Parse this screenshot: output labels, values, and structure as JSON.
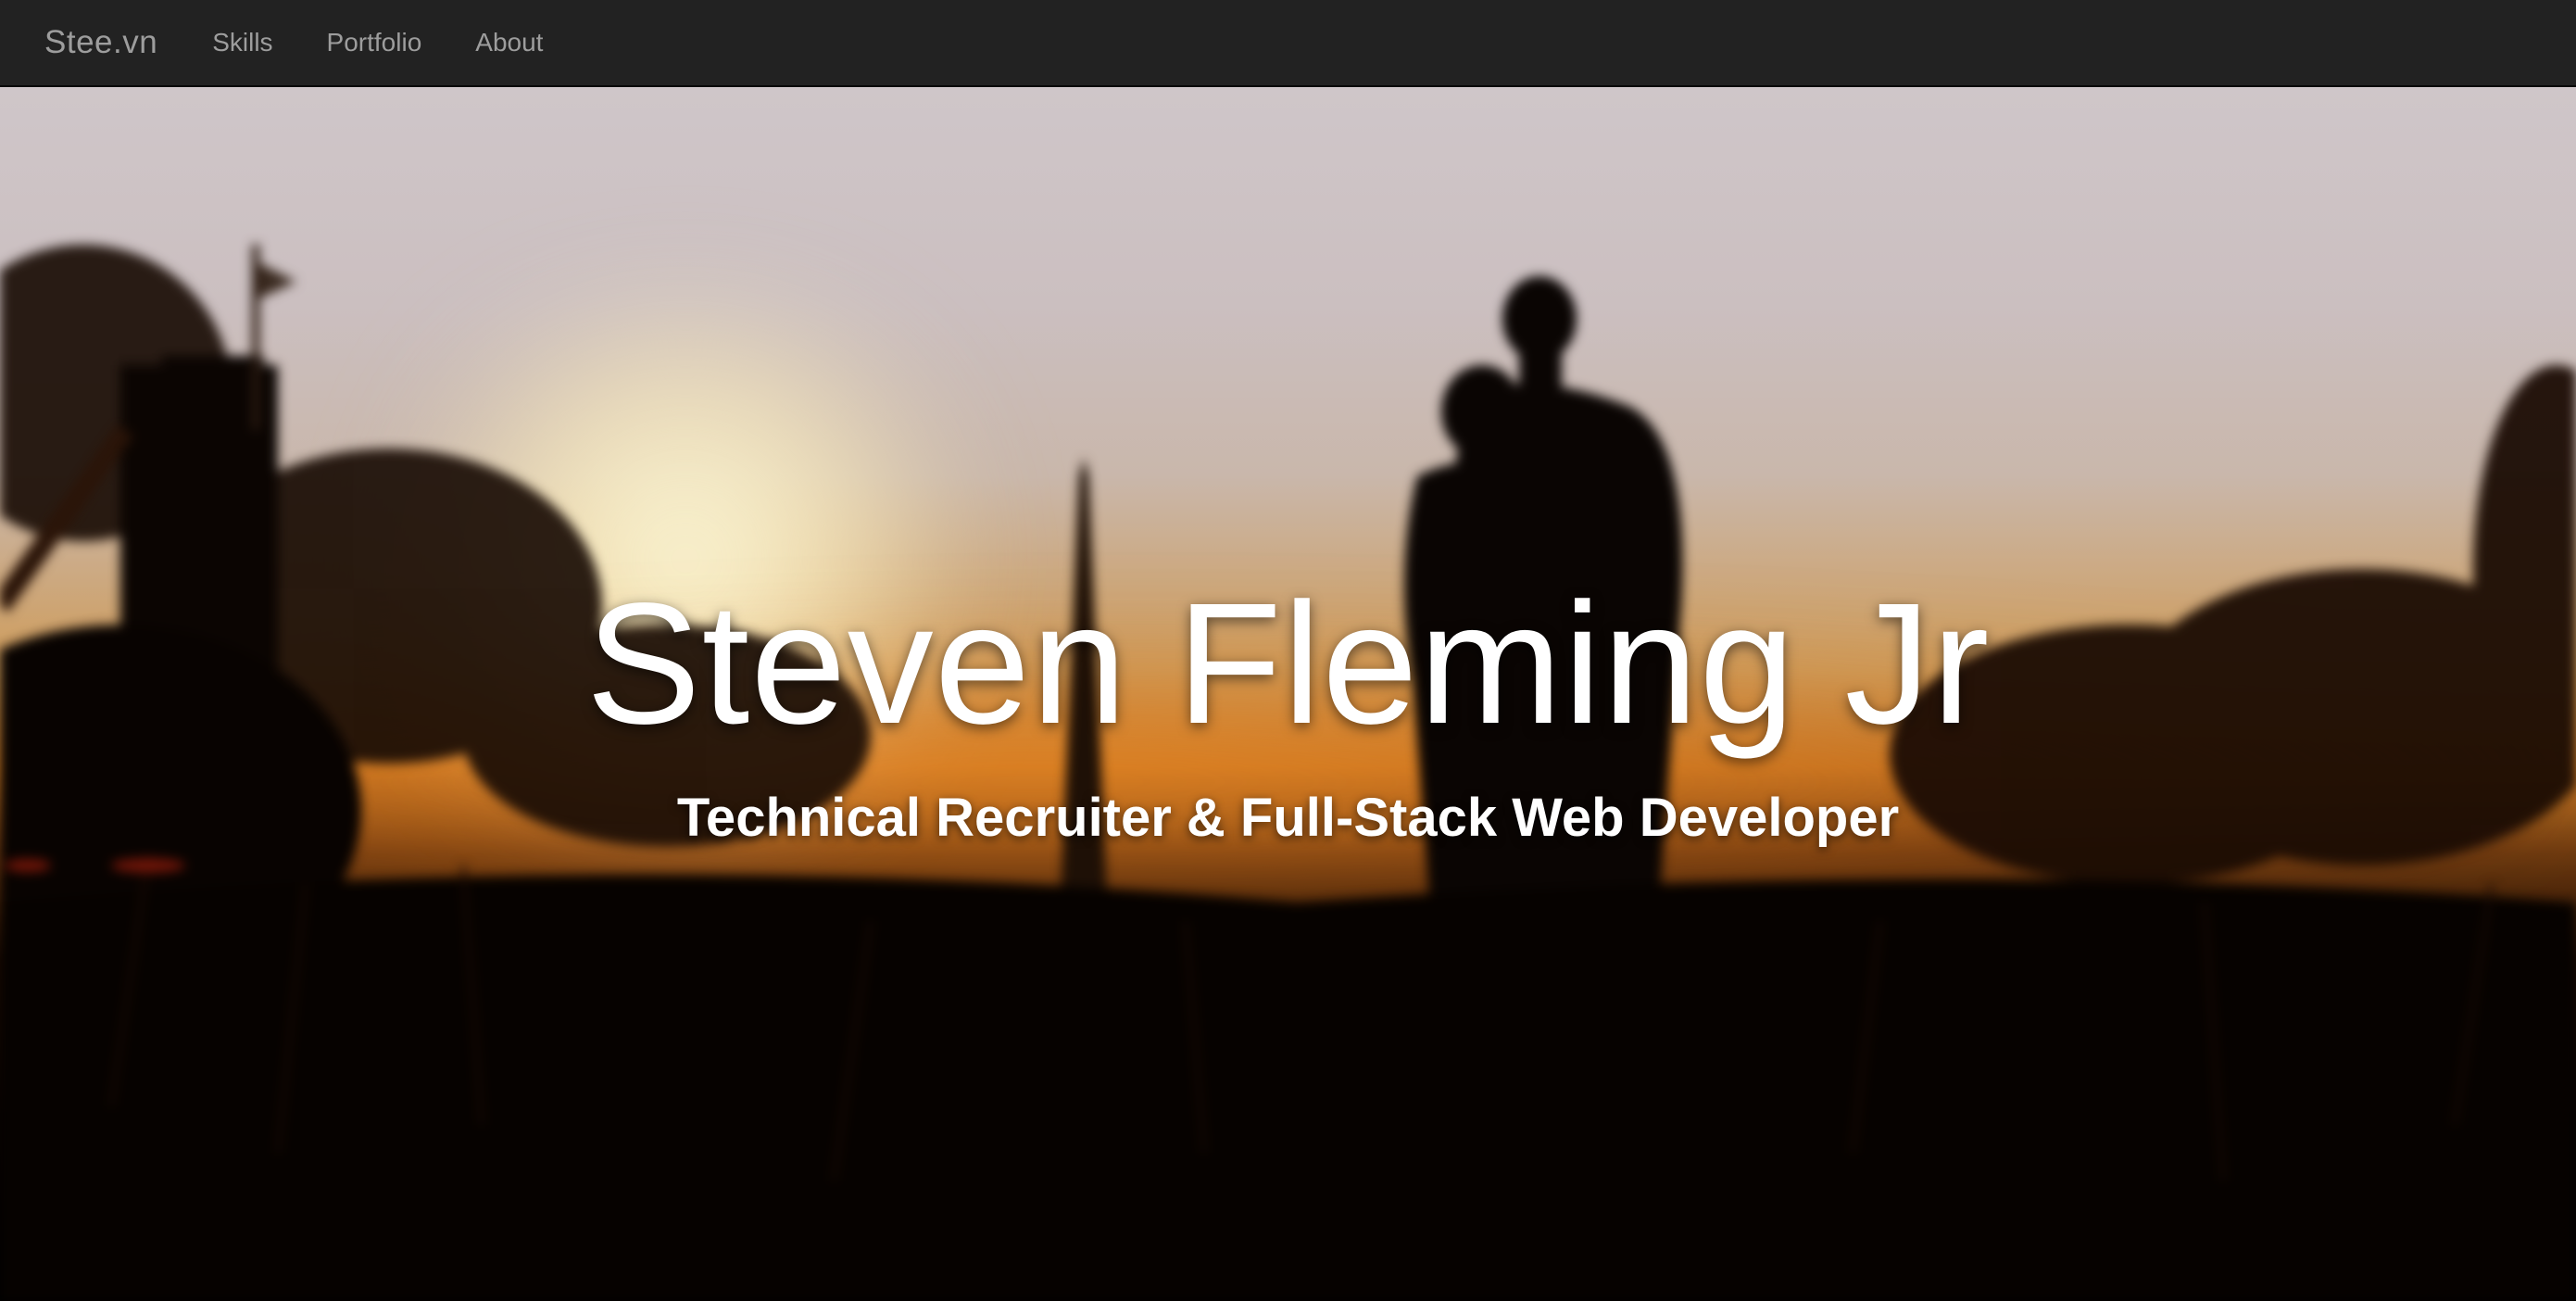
{
  "navbar": {
    "brand": "Stee.vn",
    "links": [
      {
        "label": "Skills"
      },
      {
        "label": "Portfolio"
      },
      {
        "label": "About"
      }
    ],
    "background_color": "#222222",
    "text_color": "#9d9d9d"
  },
  "hero": {
    "title": "Steven Fleming Jr",
    "subtitle": "Technical Recruiter & Full-Stack Web Developer",
    "background_image": "blurred-sunset-silhouette-couple-washington-monument",
    "text_color": "#ffffff"
  }
}
